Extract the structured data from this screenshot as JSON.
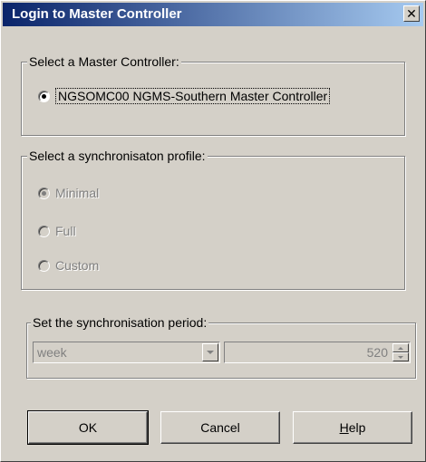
{
  "window": {
    "title": "Login to Master Controller",
    "close_glyph": "✕"
  },
  "controller_group": {
    "label": "Select a Master Controller:",
    "option": "NGSOMC00  NGMS-Southern Master Controller",
    "selected": true
  },
  "profile_group": {
    "label": "Select a synchronisaton profile:",
    "options": [
      {
        "label": "Minimal",
        "selected": true,
        "enabled": false
      },
      {
        "label": "Full",
        "selected": false,
        "enabled": false
      },
      {
        "label": "Custom",
        "selected": false,
        "enabled": false
      }
    ]
  },
  "period_group": {
    "label": "Set the synchronisation period:",
    "unit_value": "week",
    "count_value": "520"
  },
  "buttons": {
    "ok": "OK",
    "cancel": "Cancel",
    "help_first": "H",
    "help_rest": "elp"
  },
  "colors": {
    "face": "#d4d0c8",
    "title_start": "#0a246a",
    "title_end": "#a6caf0",
    "disabled_text": "#808080"
  }
}
